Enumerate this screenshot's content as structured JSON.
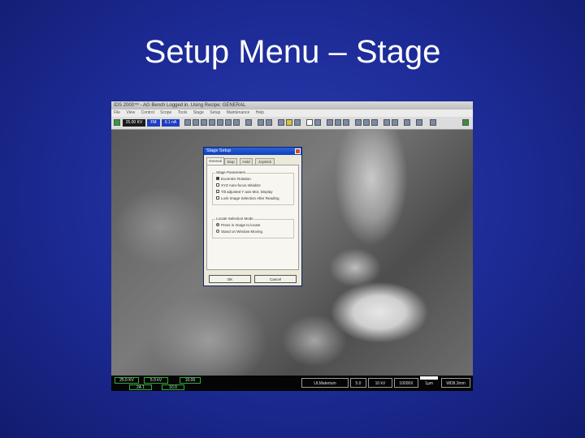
{
  "slide": {
    "title": "Setup Menu – Stage"
  },
  "app": {
    "window_title": "IDS 2000™ - AG Bench Logged in. Using Recipe: GENERAL",
    "menu": [
      "File",
      "View",
      "Control",
      "Scope",
      "Tools",
      "Stage",
      "Setup",
      "Maintenance",
      "Help"
    ],
    "toolbar": {
      "fields": [
        "25.00 KV",
        "FM",
        "0.1 nA"
      ]
    },
    "status": {
      "left": [
        "25.0 KV",
        "5.0 kV",
        "10.00",
        "2A 1",
        "10.0"
      ],
      "right": [
        "ULMaterium",
        "5.0",
        "10 kV",
        "10000X",
        "1µm",
        "WD8.3mm"
      ]
    }
  },
  "dialog": {
    "title": "Stage Setup",
    "tabs": [
      "General",
      "Stop",
      "Hold",
      "Joystick"
    ],
    "group1": {
      "label": "Stage Parameters",
      "options": [
        {
          "label": "Eucentric Rotation",
          "checked": true
        },
        {
          "label": "XYZ Auto-focus Initialize",
          "checked": false
        },
        {
          "label": "Tilt adjusted Y axis Mot. Display",
          "checked": false
        },
        {
          "label": "Lock Image Selection After Reading",
          "checked": false
        }
      ]
    },
    "group2": {
      "label": "Locate Selection Mode",
      "options": [
        {
          "label": "Press in Image to locate",
          "selected": true
        },
        {
          "label": "Stand on Window Moving",
          "selected": false
        }
      ]
    },
    "ok_label": "OK",
    "cancel_label": "Cancel"
  }
}
